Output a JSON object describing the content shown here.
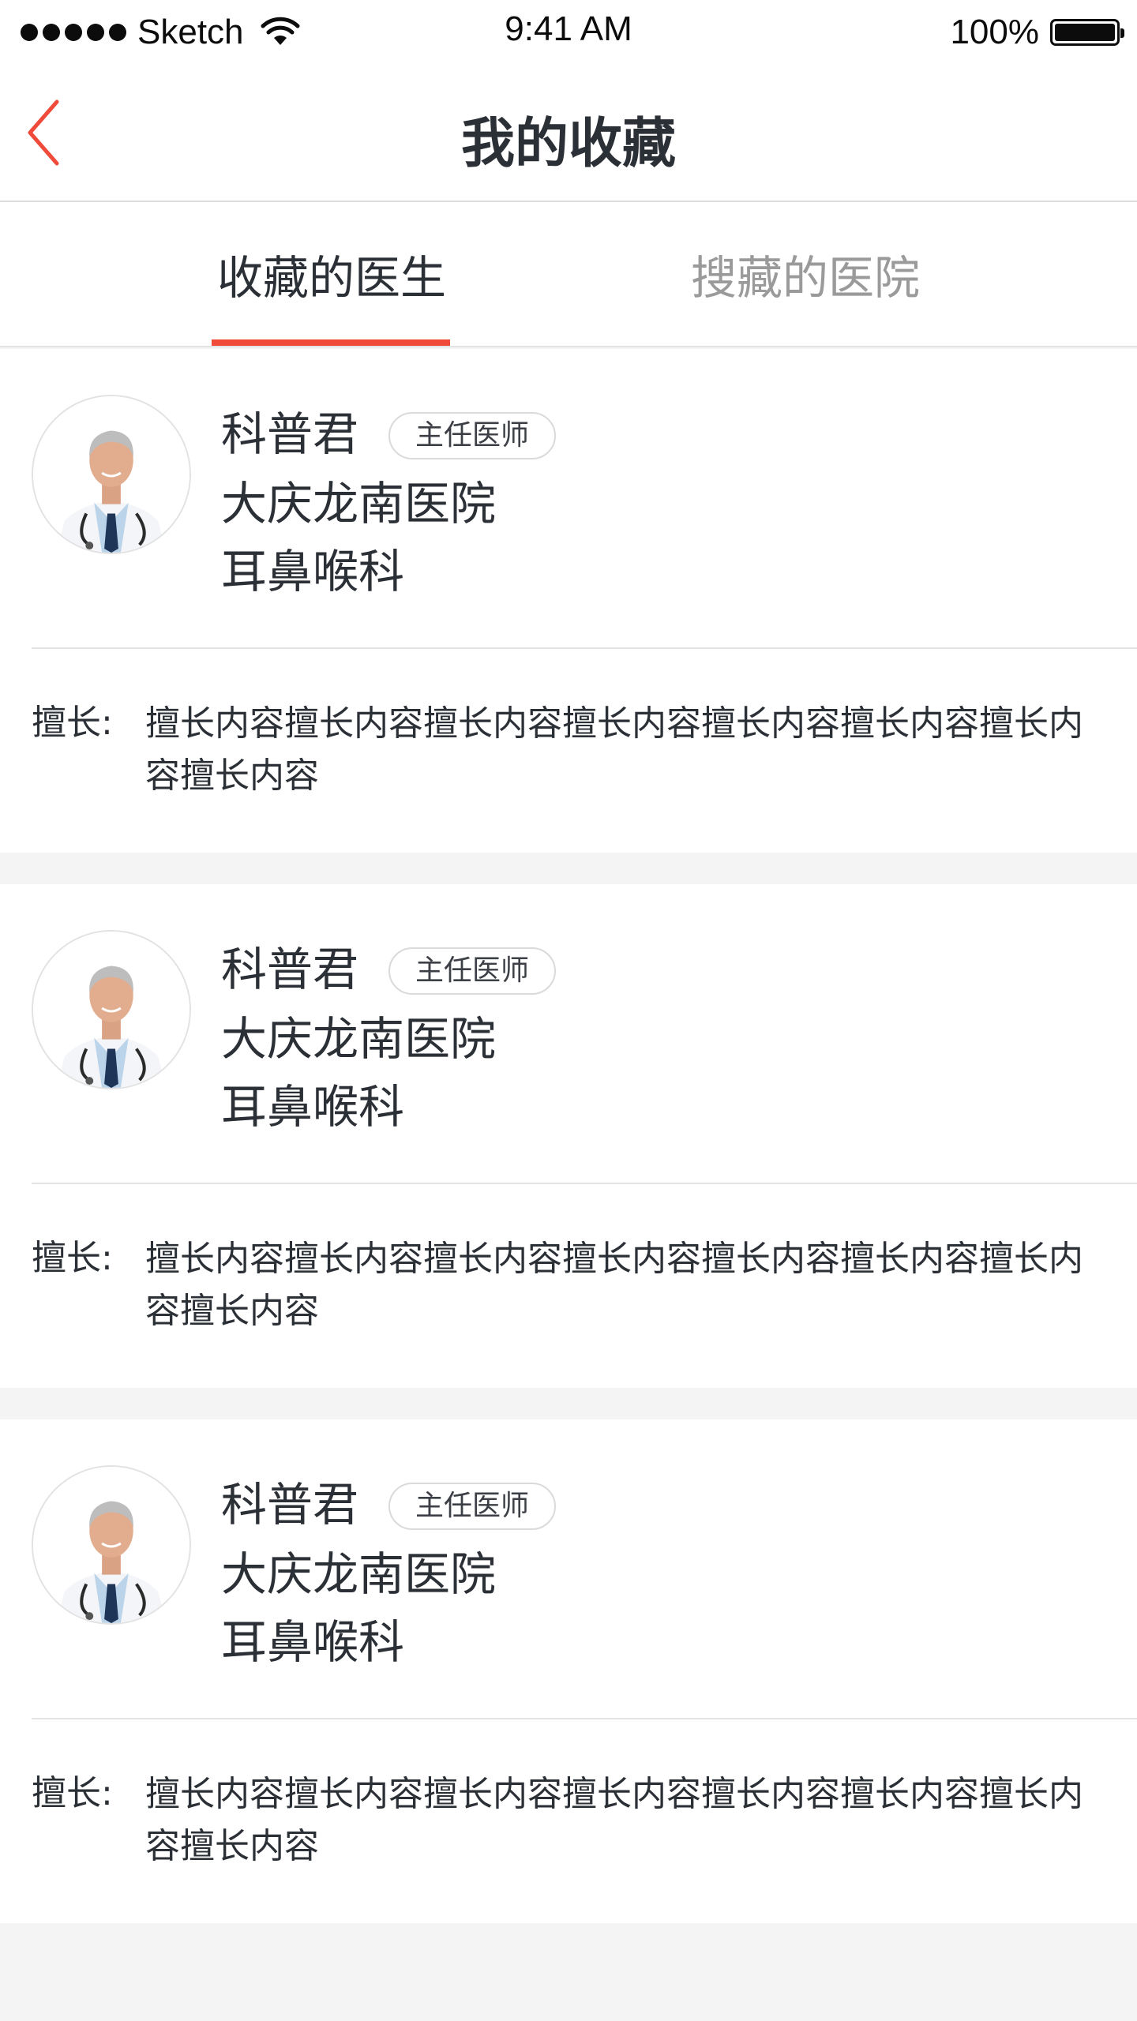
{
  "status_bar": {
    "carrier": "Sketch",
    "time": "9:41 AM",
    "battery": "100%"
  },
  "nav": {
    "title": "我的收藏"
  },
  "tabs": [
    {
      "label": "收藏的医生",
      "active": true
    },
    {
      "label": "搜藏的医院",
      "active": false
    }
  ],
  "colors": {
    "accent": "#f04a3a",
    "text": "#2b2f36",
    "inactive_tab": "#9a9a9a",
    "background": "#f4f4f4"
  },
  "doctors": [
    {
      "name": "科普君",
      "title": "主任医师",
      "hospital": "大庆龙南医院",
      "department": "耳鼻喉科",
      "specialty_label": "擅长:",
      "specialty": "擅长内容擅长内容擅长内容擅长内容擅长内容擅长内容擅长内容擅长内容"
    },
    {
      "name": "科普君",
      "title": "主任医师",
      "hospital": "大庆龙南医院",
      "department": "耳鼻喉科",
      "specialty_label": "擅长:",
      "specialty": "擅长内容擅长内容擅长内容擅长内容擅长内容擅长内容擅长内容擅长内容"
    },
    {
      "name": "科普君",
      "title": "主任医师",
      "hospital": "大庆龙南医院",
      "department": "耳鼻喉科",
      "specialty_label": "擅长:",
      "specialty": "擅长内容擅长内容擅长内容擅长内容擅长内容擅长内容擅长内容擅长内容"
    }
  ]
}
